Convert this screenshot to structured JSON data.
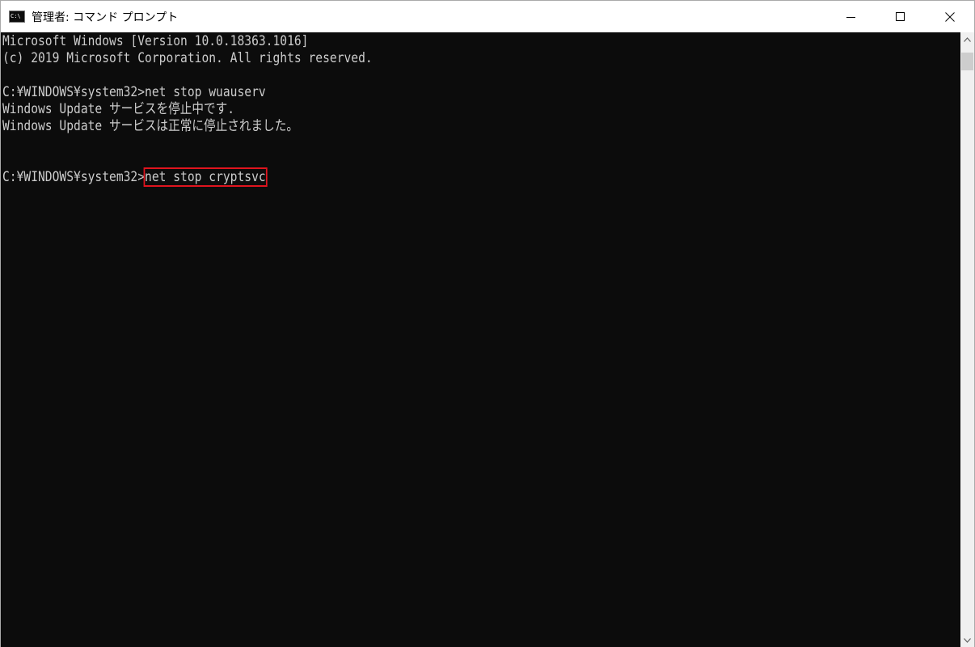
{
  "window": {
    "title": "管理者: コマンド プロンプト",
    "icon_label": "C:\\"
  },
  "console": {
    "lines": [
      "Microsoft Windows [Version 10.0.18363.1016]",
      "(c) 2019 Microsoft Corporation. All rights reserved.",
      "",
      "C:¥WINDOWS¥system32>net stop wuauserv",
      "Windows Update サービスを停止中です.",
      "Windows Update サービスは正常に停止されました。",
      "",
      "",
      "C:¥WINDOWS¥system32>"
    ],
    "prompt": "C:¥WINDOWS¥system32>",
    "current_input": "net stop cryptsvc"
  },
  "colors": {
    "console_bg": "#0c0c0c",
    "console_text": "#cccccc",
    "highlight_border": "#e0141e"
  }
}
